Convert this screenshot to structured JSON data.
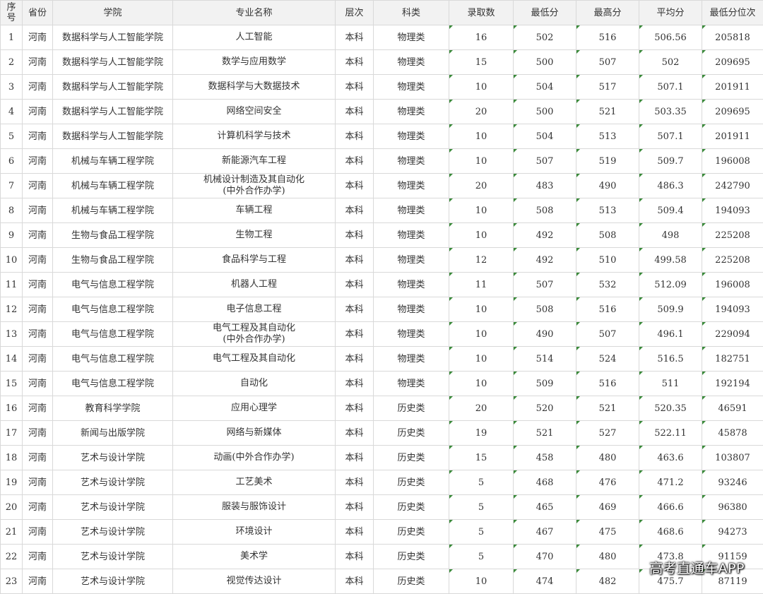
{
  "table": {
    "headers": {
      "seq": "序\n号",
      "province": "省份",
      "college": "学院",
      "major": "专业名称",
      "level": "层次",
      "subject": "科类",
      "enrolled": "录取数",
      "min": "最低分",
      "max": "最高分",
      "avg": "平均分",
      "rank": "最低分位次"
    },
    "rows": [
      {
        "seq": "1",
        "province": "河南",
        "college": "数据科学与人工智能学院",
        "major": "人工智能",
        "level": "本科",
        "subject": "物理类",
        "enrolled": "16",
        "min": "502",
        "max": "516",
        "avg": "506.56",
        "rank": "205818"
      },
      {
        "seq": "2",
        "province": "河南",
        "college": "数据科学与人工智能学院",
        "major": "数学与应用数学",
        "level": "本科",
        "subject": "物理类",
        "enrolled": "15",
        "min": "500",
        "max": "507",
        "avg": "502",
        "rank": "209695"
      },
      {
        "seq": "3",
        "province": "河南",
        "college": "数据科学与人工智能学院",
        "major": "数据科学与大数据技术",
        "level": "本科",
        "subject": "物理类",
        "enrolled": "10",
        "min": "504",
        "max": "517",
        "avg": "507.1",
        "rank": "201911"
      },
      {
        "seq": "4",
        "province": "河南",
        "college": "数据科学与人工智能学院",
        "major": "网络空间安全",
        "level": "本科",
        "subject": "物理类",
        "enrolled": "20",
        "min": "500",
        "max": "521",
        "avg": "503.35",
        "rank": "209695"
      },
      {
        "seq": "5",
        "province": "河南",
        "college": "数据科学与人工智能学院",
        "major": "计算机科学与技术",
        "level": "本科",
        "subject": "物理类",
        "enrolled": "10",
        "min": "504",
        "max": "513",
        "avg": "507.1",
        "rank": "201911"
      },
      {
        "seq": "6",
        "province": "河南",
        "college": "机械与车辆工程学院",
        "major": "新能源汽车工程",
        "level": "本科",
        "subject": "物理类",
        "enrolled": "10",
        "min": "507",
        "max": "519",
        "avg": "509.7",
        "rank": "196008"
      },
      {
        "seq": "7",
        "province": "河南",
        "college": "机械与车辆工程学院",
        "major": "机械设计制造及其自动化\n(中外合作办学)",
        "level": "本科",
        "subject": "物理类",
        "enrolled": "20",
        "min": "483",
        "max": "490",
        "avg": "486.3",
        "rank": "242790"
      },
      {
        "seq": "8",
        "province": "河南",
        "college": "机械与车辆工程学院",
        "major": "车辆工程",
        "level": "本科",
        "subject": "物理类",
        "enrolled": "10",
        "min": "508",
        "max": "513",
        "avg": "509.4",
        "rank": "194093"
      },
      {
        "seq": "9",
        "province": "河南",
        "college": "生物与食品工程学院",
        "major": "生物工程",
        "level": "本科",
        "subject": "物理类",
        "enrolled": "10",
        "min": "492",
        "max": "508",
        "avg": "498",
        "rank": "225208"
      },
      {
        "seq": "10",
        "province": "河南",
        "college": "生物与食品工程学院",
        "major": "食品科学与工程",
        "level": "本科",
        "subject": "物理类",
        "enrolled": "12",
        "min": "492",
        "max": "510",
        "avg": "499.58",
        "rank": "225208"
      },
      {
        "seq": "11",
        "province": "河南",
        "college": "电气与信息工程学院",
        "major": "机器人工程",
        "level": "本科",
        "subject": "物理类",
        "enrolled": "11",
        "min": "507",
        "max": "532",
        "avg": "512.09",
        "rank": "196008"
      },
      {
        "seq": "12",
        "province": "河南",
        "college": "电气与信息工程学院",
        "major": "电子信息工程",
        "level": "本科",
        "subject": "物理类",
        "enrolled": "10",
        "min": "508",
        "max": "516",
        "avg": "509.9",
        "rank": "194093"
      },
      {
        "seq": "13",
        "province": "河南",
        "college": "电气与信息工程学院",
        "major": "电气工程及其自动化\n(中外合作办学)",
        "level": "本科",
        "subject": "物理类",
        "enrolled": "10",
        "min": "490",
        "max": "507",
        "avg": "496.1",
        "rank": "229094"
      },
      {
        "seq": "14",
        "province": "河南",
        "college": "电气与信息工程学院",
        "major": "电气工程及其自动化",
        "level": "本科",
        "subject": "物理类",
        "enrolled": "10",
        "min": "514",
        "max": "524",
        "avg": "516.5",
        "rank": "182751"
      },
      {
        "seq": "15",
        "province": "河南",
        "college": "电气与信息工程学院",
        "major": "自动化",
        "level": "本科",
        "subject": "物理类",
        "enrolled": "10",
        "min": "509",
        "max": "516",
        "avg": "511",
        "rank": "192194"
      },
      {
        "seq": "16",
        "province": "河南",
        "college": "教育科学学院",
        "major": "应用心理学",
        "level": "本科",
        "subject": "历史类",
        "enrolled": "20",
        "min": "520",
        "max": "521",
        "avg": "520.35",
        "rank": "46591"
      },
      {
        "seq": "17",
        "province": "河南",
        "college": "新闻与出版学院",
        "major": "网络与新媒体",
        "level": "本科",
        "subject": "历史类",
        "enrolled": "19",
        "min": "521",
        "max": "527",
        "avg": "522.11",
        "rank": "45878"
      },
      {
        "seq": "18",
        "province": "河南",
        "college": "艺术与设计学院",
        "major": "动画(中外合作办学)",
        "level": "本科",
        "subject": "历史类",
        "enrolled": "15",
        "min": "458",
        "max": "480",
        "avg": "463.6",
        "rank": "103807"
      },
      {
        "seq": "19",
        "province": "河南",
        "college": "艺术与设计学院",
        "major": "工艺美术",
        "level": "本科",
        "subject": "历史类",
        "enrolled": "5",
        "min": "468",
        "max": "476",
        "avg": "471.2",
        "rank": "93246"
      },
      {
        "seq": "20",
        "province": "河南",
        "college": "艺术与设计学院",
        "major": "服装与服饰设计",
        "level": "本科",
        "subject": "历史类",
        "enrolled": "5",
        "min": "465",
        "max": "469",
        "avg": "466.6",
        "rank": "96380"
      },
      {
        "seq": "21",
        "province": "河南",
        "college": "艺术与设计学院",
        "major": "环境设计",
        "level": "本科",
        "subject": "历史类",
        "enrolled": "5",
        "min": "467",
        "max": "475",
        "avg": "468.6",
        "rank": "94273"
      },
      {
        "seq": "22",
        "province": "河南",
        "college": "艺术与设计学院",
        "major": "美术学",
        "level": "本科",
        "subject": "历史类",
        "enrolled": "5",
        "min": "470",
        "max": "480",
        "avg": "473.8",
        "rank": "91159"
      },
      {
        "seq": "23",
        "province": "河南",
        "college": "艺术与设计学院",
        "major": "视觉传达设计",
        "level": "本科",
        "subject": "历史类",
        "enrolled": "10",
        "min": "474",
        "max": "482",
        "avg": "475.7",
        "rank": "87119"
      }
    ]
  },
  "watermark": "高考直通车APP"
}
